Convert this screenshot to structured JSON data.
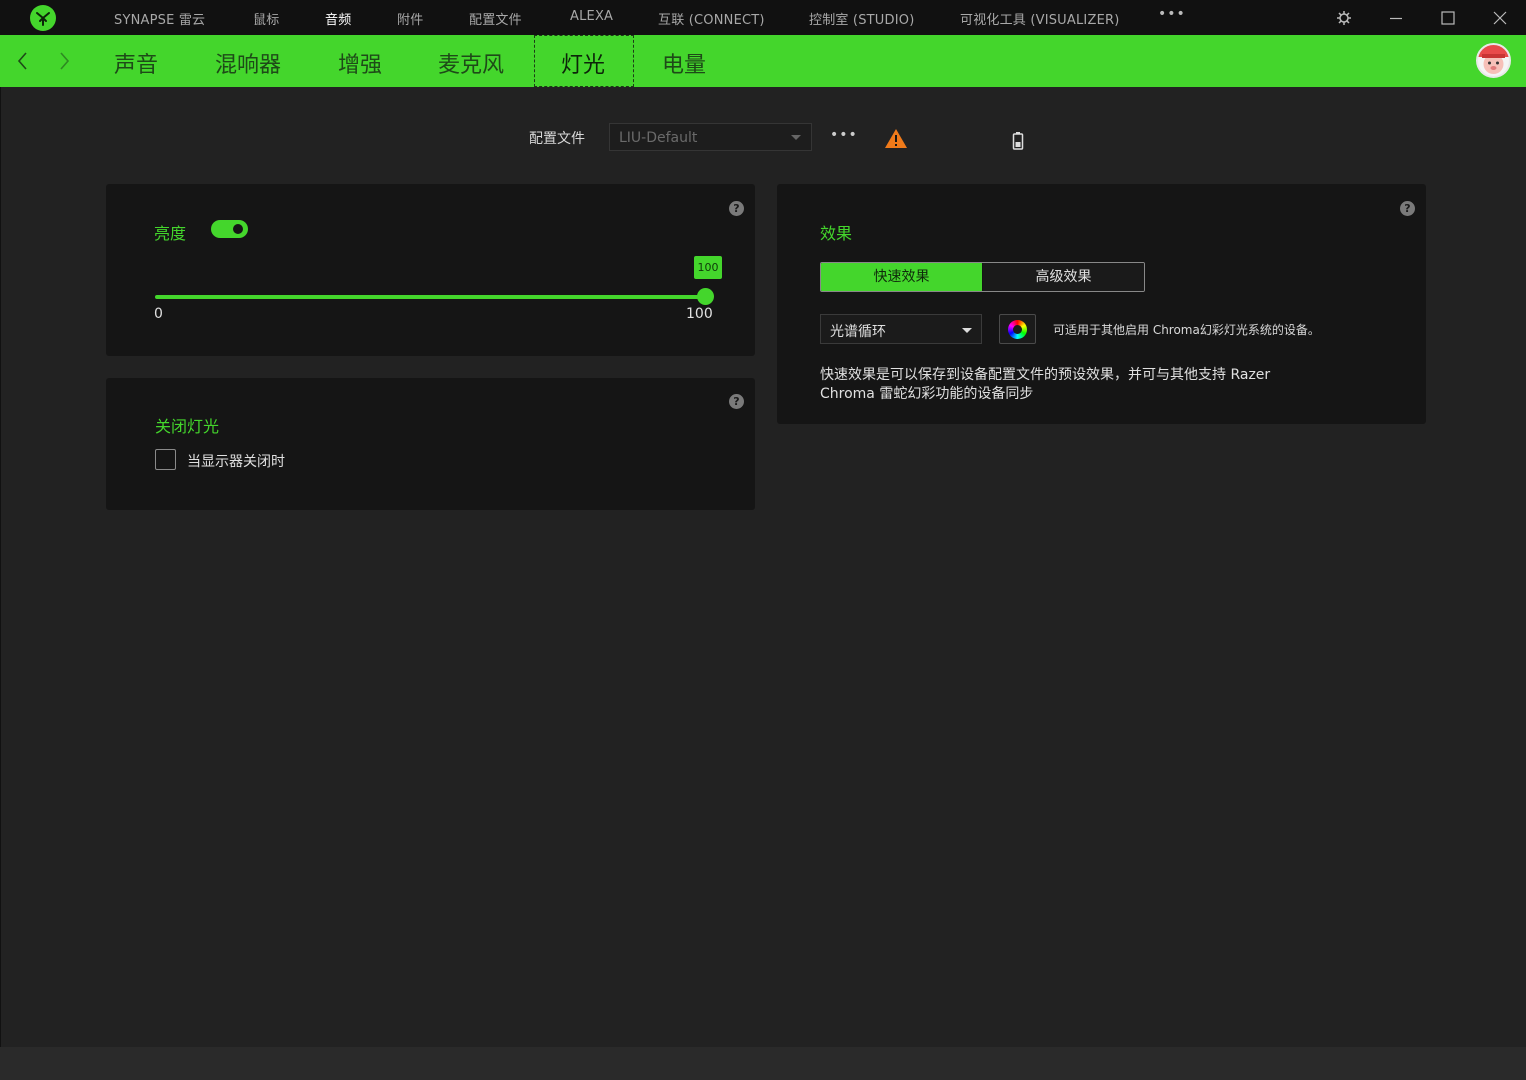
{
  "topnav": {
    "items": [
      {
        "label": "SYNAPSE 雷云"
      },
      {
        "label": "鼠标"
      },
      {
        "label": "音频"
      },
      {
        "label": "附件"
      },
      {
        "label": "配置文件"
      },
      {
        "label": "ALEXA"
      },
      {
        "label": "互联 (CONNECT)"
      },
      {
        "label": "控制室 (STUDIO)"
      },
      {
        "label": "可视化工具 (VISUALIZER)"
      }
    ],
    "active": "音频",
    "more_label": "•••"
  },
  "subtabs": {
    "items": [
      {
        "label": "声音"
      },
      {
        "label": "混响器"
      },
      {
        "label": "增强"
      },
      {
        "label": "麦克风"
      },
      {
        "label": "灯光"
      },
      {
        "label": "电量"
      }
    ],
    "active": "灯光"
  },
  "profile": {
    "label": "配置文件",
    "value": "LIU-Default",
    "more_label": "•••"
  },
  "brightness": {
    "title": "亮度",
    "enabled": true,
    "value": "100",
    "min_label": "0",
    "max_label": "100"
  },
  "lights_off": {
    "title": "关闭灯光",
    "checkbox_label": "当显示器关闭时",
    "checked": false
  },
  "effects": {
    "title": "效果",
    "tab_quick": "快速效果",
    "tab_advanced": "高级效果",
    "selected_effect": "光谱循环",
    "chroma_note": "可适用于其他启用 Chroma幻彩灯光系统的设备。",
    "description": "快速效果是可以保存到设备配置文件的预设效果，并可与其他支持 Razer Chroma 雷蛇幻彩功能的设备同步"
  },
  "help_label": "?",
  "colors": {
    "accent": "#44d62c",
    "background": "#222222",
    "panel": "#151515",
    "titlebar": "#111111",
    "warning": "#f07a1a"
  }
}
